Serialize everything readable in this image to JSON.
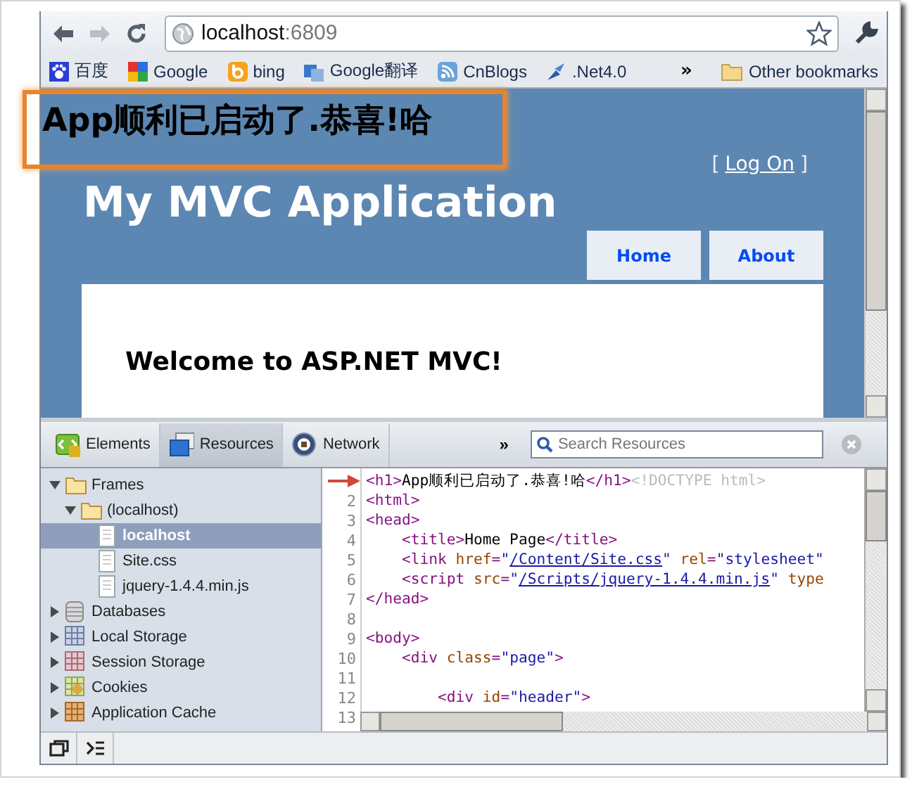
{
  "browser": {
    "address": {
      "host": "localhost",
      "port": ":6809"
    },
    "bookmarks": [
      {
        "label": "百度",
        "kind": "paw"
      },
      {
        "label": "Google",
        "kind": "google"
      },
      {
        "label": "bing",
        "kind": "bing"
      },
      {
        "label": "Google翻译",
        "kind": "translate"
      },
      {
        "label": "CnBlogs",
        "kind": "feed"
      },
      {
        "label": ".Net4.0",
        "kind": "net"
      }
    ],
    "bookmarks_overflow": "»",
    "other_bookmarks": "Other bookmarks"
  },
  "page": {
    "heading": "App顺利已启动了.恭喜!哈",
    "login": {
      "open": "[",
      "link": "Log On",
      "close": "]"
    },
    "title": "My MVC Application",
    "menu": [
      "Home",
      "About"
    ],
    "welcome": "Welcome to ASP.NET MVC!"
  },
  "devtools": {
    "tabs": [
      {
        "label": "Elements",
        "kind": "elements",
        "selected": false
      },
      {
        "label": "Resources",
        "kind": "resources",
        "selected": true
      },
      {
        "label": "Network",
        "kind": "network",
        "selected": false
      }
    ],
    "overflow": "»",
    "search": {
      "placeholder": "Search Resources"
    },
    "tree": [
      {
        "label": "Frames",
        "kind": "folder",
        "expanded": true,
        "selected": false,
        "children": [
          {
            "label": "(localhost)",
            "kind": "folder",
            "expanded": true,
            "selected": false,
            "children": [
              {
                "label": "localhost",
                "kind": "file",
                "selected": true
              },
              {
                "label": "Site.css",
                "kind": "file",
                "selected": false
              },
              {
                "label": "jquery-1.4.4.min.js",
                "kind": "file",
                "selected": false
              }
            ]
          }
        ]
      },
      {
        "label": "Databases",
        "kind": "database",
        "expanded": false,
        "selected": false
      },
      {
        "label": "Local Storage",
        "kind": "local-storage",
        "expanded": false,
        "selected": false
      },
      {
        "label": "Session Storage",
        "kind": "session-storage",
        "expanded": false,
        "selected": false
      },
      {
        "label": "Cookies",
        "kind": "cookies",
        "expanded": false,
        "selected": false
      },
      {
        "label": "Application Cache",
        "kind": "cache",
        "expanded": false,
        "selected": false
      }
    ],
    "code": [
      {
        "arrow": true,
        "tokens": [
          {
            "kind": "tag",
            "text": "<h1>"
          },
          {
            "kind": "text",
            "text": "App顺利已启动了.恭喜!哈"
          },
          {
            "kind": "tag",
            "text": "</h1>"
          },
          {
            "kind": "comment",
            "text": "<!DOCTYPE html>"
          }
        ]
      },
      {
        "arrow": false,
        "number": "2",
        "tokens": [
          {
            "kind": "tag",
            "text": "<html>"
          }
        ]
      },
      {
        "arrow": false,
        "number": "3",
        "tokens": [
          {
            "kind": "tag",
            "text": "<head>"
          }
        ]
      },
      {
        "arrow": false,
        "number": "4",
        "tokens": [
          {
            "kind": "tag",
            "text": "    <title>"
          },
          {
            "kind": "text",
            "text": "Home Page"
          },
          {
            "kind": "tag",
            "text": "</title>"
          }
        ]
      },
      {
        "arrow": false,
        "number": "5",
        "tokens": [
          {
            "kind": "tag",
            "text": "    <link "
          },
          {
            "kind": "attr",
            "text": "href"
          },
          {
            "kind": "tag",
            "text": "="
          },
          {
            "kind": "value",
            "text": "\""
          },
          {
            "kind": "link",
            "text": "/Content/Site.css"
          },
          {
            "kind": "value",
            "text": "\""
          },
          {
            "kind": "attr",
            "text": " rel"
          },
          {
            "kind": "tag",
            "text": "="
          },
          {
            "kind": "value",
            "text": "\"stylesheet\""
          }
        ]
      },
      {
        "arrow": false,
        "number": "6",
        "tokens": [
          {
            "kind": "tag",
            "text": "    <script "
          },
          {
            "kind": "attr",
            "text": "src"
          },
          {
            "kind": "tag",
            "text": "="
          },
          {
            "kind": "value",
            "text": "\""
          },
          {
            "kind": "link",
            "text": "/Scripts/jquery-1.4.4.min.js"
          },
          {
            "kind": "value",
            "text": "\""
          },
          {
            "kind": "attr",
            "text": " type"
          }
        ]
      },
      {
        "arrow": false,
        "number": "7",
        "tokens": [
          {
            "kind": "tag",
            "text": "</head>"
          }
        ]
      },
      {
        "arrow": false,
        "number": "8"
      },
      {
        "arrow": false,
        "number": "9",
        "tokens": [
          {
            "kind": "tag",
            "text": "<body>"
          }
        ]
      },
      {
        "arrow": false,
        "number": "10",
        "tokens": [
          {
            "kind": "tag",
            "text": "    <div "
          },
          {
            "kind": "attr",
            "text": "class"
          },
          {
            "kind": "tag",
            "text": "="
          },
          {
            "kind": "value",
            "text": "\"page\""
          },
          {
            "kind": "tag",
            "text": ">"
          }
        ]
      },
      {
        "arrow": false,
        "number": "11"
      },
      {
        "arrow": false,
        "number": "12",
        "tokens": [
          {
            "kind": "tag",
            "text": "        <div "
          },
          {
            "kind": "attr",
            "text": "id"
          },
          {
            "kind": "tag",
            "text": "="
          },
          {
            "kind": "value",
            "text": "\"header\""
          },
          {
            "kind": "tag",
            "text": ">"
          }
        ]
      },
      {
        "arrow": false,
        "number": "13"
      }
    ]
  }
}
